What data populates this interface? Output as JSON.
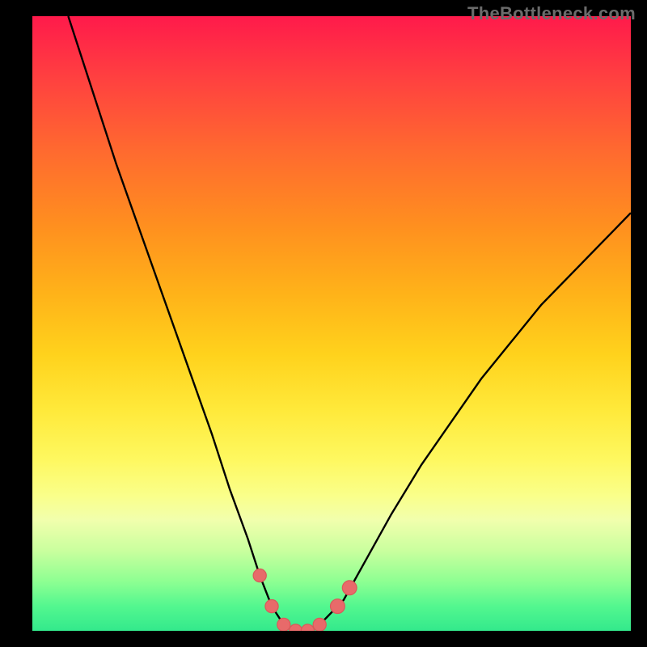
{
  "watermark": "TheBottleneck.com",
  "colors": {
    "frame_bg": "#000000",
    "curve_stroke": "#000000",
    "marker_fill": "#e86a6a",
    "marker_stroke": "#d85a5a"
  },
  "chart_data": {
    "type": "line",
    "title": "",
    "xlabel": "",
    "ylabel": "",
    "xlim": [
      0,
      100
    ],
    "ylim": [
      0,
      100
    ],
    "grid": false,
    "legend": false,
    "series": [
      {
        "name": "bottleneck-curve",
        "x": [
          6,
          10,
          14,
          18,
          22,
          26,
          30,
          33,
          36,
          38,
          40,
          42,
          44,
          46,
          48,
          52,
          56,
          60,
          65,
          70,
          75,
          80,
          85,
          90,
          95,
          100
        ],
        "y": [
          100,
          88,
          76,
          65,
          54,
          43,
          32,
          23,
          15,
          9,
          4,
          1,
          0,
          0,
          1,
          5,
          12,
          19,
          27,
          34,
          41,
          47,
          53,
          58,
          63,
          68
        ]
      }
    ],
    "markers": [
      {
        "x": 38,
        "y": 9,
        "r": 1.6
      },
      {
        "x": 40,
        "y": 4,
        "r": 1.6
      },
      {
        "x": 42,
        "y": 1,
        "r": 1.6
      },
      {
        "x": 44,
        "y": 0,
        "r": 1.6
      },
      {
        "x": 46,
        "y": 0,
        "r": 1.6
      },
      {
        "x": 48,
        "y": 1,
        "r": 1.6
      },
      {
        "x": 51,
        "y": 4,
        "r": 2.2
      },
      {
        "x": 53,
        "y": 7,
        "r": 2.2
      }
    ],
    "annotations": []
  }
}
